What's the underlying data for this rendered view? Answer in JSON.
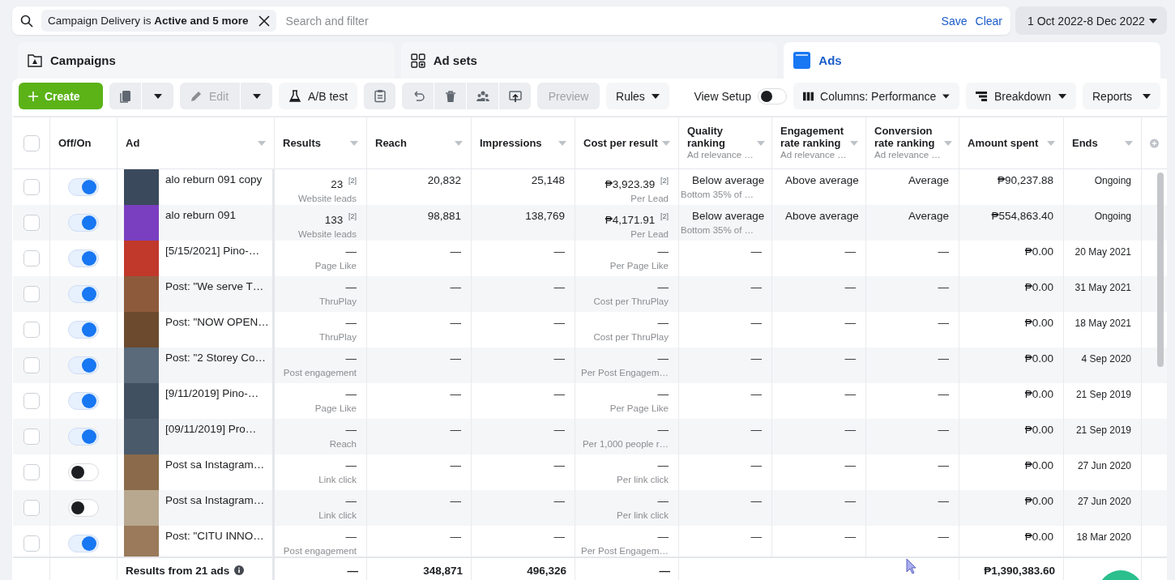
{
  "filter": {
    "chip": "Campaign Delivery is **Active and 5 more**",
    "placeholder": "Search and filter",
    "save": "Save",
    "clear": "Clear",
    "date_range": "1 Oct 2022-8 Dec 2022"
  },
  "tabs": [
    {
      "label": "Campaigns",
      "selected": false
    },
    {
      "label": "Ad sets",
      "selected": false
    },
    {
      "label": "Ads",
      "selected": true
    }
  ],
  "toolbar": {
    "create": "Create",
    "edit": {
      "label": "Edit",
      "disabled": true
    },
    "ab_test": "A/B test",
    "preview": {
      "label": "Preview",
      "disabled": true
    },
    "rules": "Rules",
    "view_setup": {
      "label": "View Setup",
      "on": false
    },
    "columns": "Columns: Performance",
    "breakdown": "Breakdown",
    "reports": "Reports"
  },
  "table": {
    "select_all_checked": false,
    "columns": [
      {
        "label": "Off/On"
      },
      {
        "label": "Ad"
      },
      {
        "label": "Results"
      },
      {
        "label": "Reach"
      },
      {
        "label": "Impressions"
      },
      {
        "label": "Cost per result"
      },
      {
        "label": "Quality ranking",
        "sub": "Ad relevance …"
      },
      {
        "label": "Engagement rate ranking",
        "sub": "Ad relevance …"
      },
      {
        "label": "Conversion rate ranking",
        "sub": "Ad relevance …"
      },
      {
        "label": "Amount spent"
      },
      {
        "label": "Ends"
      }
    ],
    "rows": [
      {
        "checked": false,
        "on": true,
        "name": "alo reburn 091 copy",
        "results": "23 $^{[2]}$",
        "result_type": "Website leads",
        "reach": "20,832",
        "impressions": "25,148",
        "cost": "₱3,923.39 $^{[2]}$",
        "cost_type": "Per Lead",
        "quality": "Below average",
        "quality_note": "Bottom 35% of …",
        "engagement": "Above average",
        "conversion": "Average",
        "amount": "₱90,237.88",
        "ends": "Ongoing"
      },
      {
        "checked": false,
        "on": true,
        "name": "alo reburn 091",
        "results": "133 $^{[2]}$",
        "result_type": "Website leads",
        "reach": "98,881",
        "impressions": "138,769",
        "cost": "₱4,171.91 $^{[2]}$",
        "cost_type": "Per Lead",
        "quality": "Below average",
        "quality_note": "Bottom 35% of …",
        "engagement": "Above average",
        "conversion": "Average",
        "amount": "₱554,863.40",
        "ends": "Ongoing"
      },
      {
        "checked": false,
        "on": true,
        "name": "[5/15/2021] Pino-…",
        "results": "—",
        "result_type": "Page Like",
        "reach": "—",
        "impressions": "—",
        "cost": "—",
        "cost_type": "Per Page Like",
        "quality": "—",
        "engagement": "—",
        "conversion": "—",
        "amount": "₱0.00",
        "ends": "20 May 2021"
      },
      {
        "checked": false,
        "on": true,
        "name": "Post: \"We serve T…",
        "results": "—",
        "result_type": "ThruPlay",
        "reach": "—",
        "impressions": "—",
        "cost": "—",
        "cost_type": "Cost per ThruPlay",
        "quality": "—",
        "engagement": "—",
        "conversion": "—",
        "amount": "₱0.00",
        "ends": "31 May 2021"
      },
      {
        "checked": false,
        "on": true,
        "name": "Post: \"NOW OPEN…",
        "results": "—",
        "result_type": "ThruPlay",
        "reach": "—",
        "impressions": "—",
        "cost": "—",
        "cost_type": "Cost per ThruPlay",
        "quality": "—",
        "engagement": "—",
        "conversion": "—",
        "amount": "₱0.00",
        "ends": "18 May 2021"
      },
      {
        "checked": false,
        "on": true,
        "name": "Post: \"2 Storey Co…",
        "results": "—",
        "result_type": "Post engagement",
        "reach": "—",
        "impressions": "—",
        "cost": "—",
        "cost_type": "Per Post Engagem…",
        "quality": "—",
        "engagement": "—",
        "conversion": "—",
        "amount": "₱0.00",
        "ends": "4 Sep 2020"
      },
      {
        "checked": false,
        "on": true,
        "name": "[9/11/2019] Pino-…",
        "results": "—",
        "result_type": "Page Like",
        "reach": "—",
        "impressions": "—",
        "cost": "—",
        "cost_type": "Per Page Like",
        "quality": "—",
        "engagement": "—",
        "conversion": "—",
        "amount": "₱0.00",
        "ends": "21 Sep 2019"
      },
      {
        "checked": false,
        "on": true,
        "name": "[09/11/2019] Pro…",
        "results": "—",
        "result_type": "Reach",
        "reach": "—",
        "impressions": "—",
        "cost": "—",
        "cost_type": "Per 1,000 people r…",
        "quality": "—",
        "engagement": "—",
        "conversion": "—",
        "amount": "₱0.00",
        "ends": "21 Sep 2019"
      },
      {
        "checked": false,
        "on": false,
        "name": "Post sa Instagram…",
        "results": "—",
        "result_type": "Link click",
        "reach": "—",
        "impressions": "—",
        "cost": "—",
        "cost_type": "Per link click",
        "quality": "—",
        "engagement": "—",
        "conversion": "—",
        "amount": "₱0.00",
        "ends": "27 Jun 2020"
      },
      {
        "checked": false,
        "on": false,
        "name": "Post sa Instagram…",
        "results": "—",
        "result_type": "Link click",
        "reach": "—",
        "impressions": "—",
        "cost": "—",
        "cost_type": "Per link click",
        "quality": "—",
        "engagement": "—",
        "conversion": "—",
        "amount": "₱0.00",
        "ends": "27 Jun 2020"
      },
      {
        "checked": false,
        "on": true,
        "name": "Post: \"CITU INNO…",
        "results": "—",
        "result_type": "Post engagement",
        "reach": "—",
        "impressions": "—",
        "cost": "—",
        "cost_type": "Per Post Engagem…",
        "quality": "—",
        "engagement": "—",
        "conversion": "—",
        "amount": "₱0.00",
        "ends": "18 Mar 2020"
      }
    ],
    "footer": {
      "label": "Results from 21 ads",
      "results": "—",
      "reach": "348,871",
      "impressions": "496,326",
      "cost": "—",
      "amount": "₱1,390,383.60"
    }
  }
}
